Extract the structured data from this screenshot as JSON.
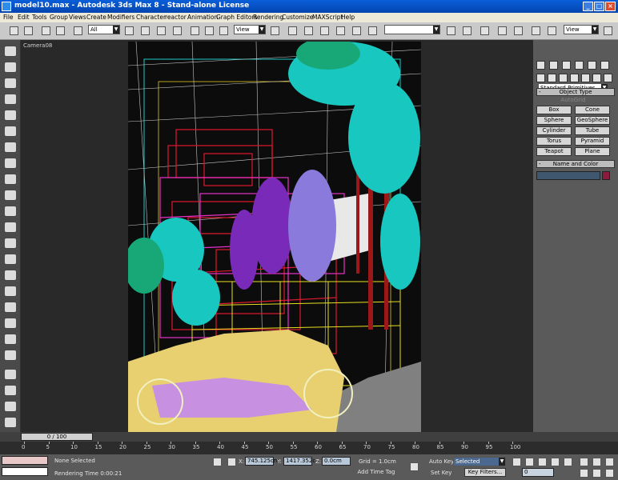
{
  "window": {
    "title": "model10.max - Autodesk 3ds Max 8 - Stand-alone License"
  },
  "menu": [
    "File",
    "Edit",
    "Tools",
    "Group",
    "Views",
    "Create",
    "Modifiers",
    "Character",
    "reactor",
    "Animation",
    "Graph Editors",
    "Rendering",
    "Customize",
    "MAXScript",
    "Help"
  ],
  "toolbar": {
    "selection_filter": "All",
    "ref_coord": "View",
    "named_sel": "",
    "ref_coord_right": "View"
  },
  "viewport": {
    "label": "Camera08"
  },
  "command_panel": {
    "category": "Standard Primitives",
    "object_type_title": "Object Type",
    "autogrid": "AutoGrid",
    "buttons": [
      "Box",
      "Cone",
      "Sphere",
      "GeoSphere",
      "Cylinder",
      "Tube",
      "Torus",
      "Pyramid",
      "Teapot",
      "Plane"
    ],
    "name_color_title": "Name and Color",
    "swatch": "#8a1a3e"
  },
  "timeline": {
    "slider": "0 / 100",
    "ticks": [
      "0",
      "5",
      "10",
      "15",
      "20",
      "25",
      "30",
      "35",
      "40",
      "45",
      "50",
      "55",
      "60",
      "65",
      "70",
      "75",
      "80",
      "85",
      "90",
      "95",
      "100"
    ]
  },
  "status": {
    "selection": "None Selected",
    "prompt": "Rendering Time  0:00:21",
    "x_label": "X:",
    "x_value": "745.125cm",
    "y_label": "Y:",
    "y_value": "1417.352c",
    "z_label": "Z:",
    "z_value": "0.0cm",
    "grid": "Grid = 1.0cm",
    "add_time_tag": "Add Time Tag",
    "auto_key": "Auto Key",
    "auto_key_mode": "Selected",
    "set_key": "Set Key",
    "key_filters": "Key Filters...",
    "frame": "0"
  },
  "colors": {
    "title_bar": "#0a5fd8",
    "viewport_bg": "#292929",
    "render_bg": "#0c0c0c"
  }
}
